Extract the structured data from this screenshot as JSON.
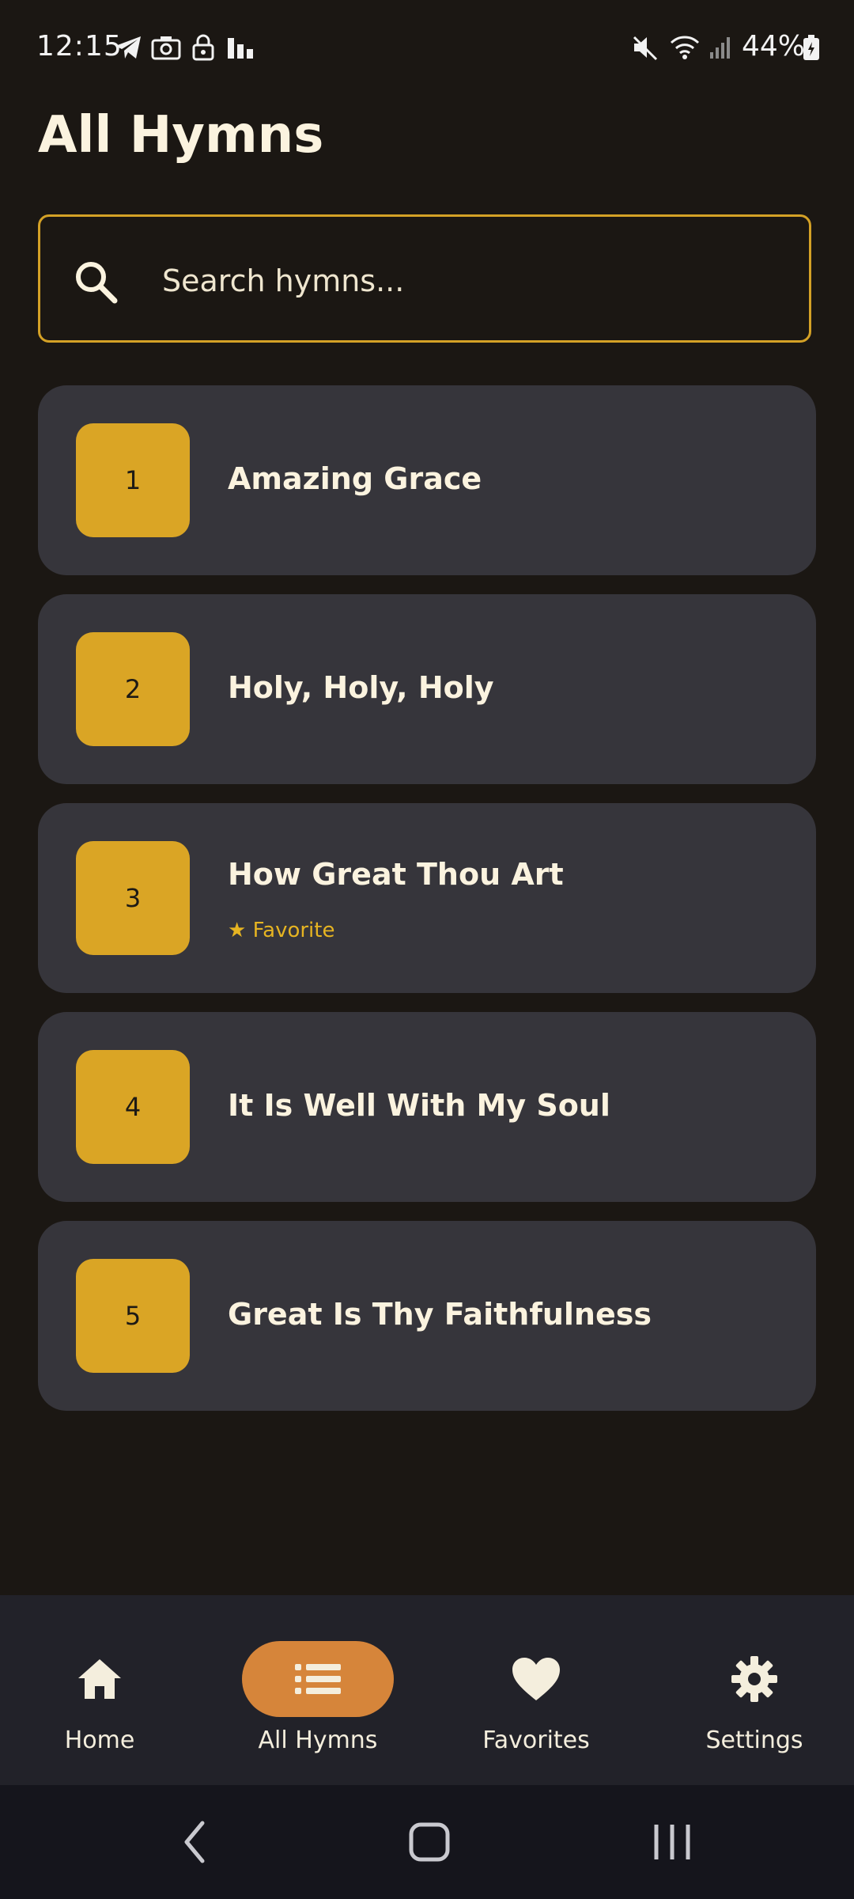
{
  "status_bar": {
    "time": "12:15",
    "battery": "44%",
    "icons": [
      "telegram-icon",
      "camera-icon",
      "lock-icon",
      "chart-icon",
      "mute-icon",
      "wifi-icon",
      "signal-icon",
      "battery-icon"
    ]
  },
  "page": {
    "title": "All Hymns"
  },
  "search": {
    "placeholder": "Search hymns...",
    "value": ""
  },
  "hymns": [
    {
      "number": "1",
      "title": "Amazing Grace",
      "favorite": ""
    },
    {
      "number": "2",
      "title": "Holy, Holy, Holy",
      "favorite": ""
    },
    {
      "number": "3",
      "title": "How Great Thou Art",
      "favorite": "★ Favorite"
    },
    {
      "number": "4",
      "title": "It Is Well With My Soul",
      "favorite": ""
    },
    {
      "number": "5",
      "title": "Great Is Thy Faithfulness",
      "favorite": ""
    }
  ],
  "nav": {
    "items": [
      {
        "label": "Home",
        "icon": "home-icon",
        "active": false
      },
      {
        "label": "All Hymns",
        "icon": "list-icon",
        "active": true
      },
      {
        "label": "Favorites",
        "icon": "heart-icon",
        "active": false
      },
      {
        "label": "Settings",
        "icon": "gear-icon",
        "active": false
      }
    ]
  },
  "colors": {
    "background": "#1b1713",
    "card": "#36353b",
    "accent_gold": "#daa525",
    "active_tab": "#d6853a",
    "text": "#fbf3df"
  }
}
